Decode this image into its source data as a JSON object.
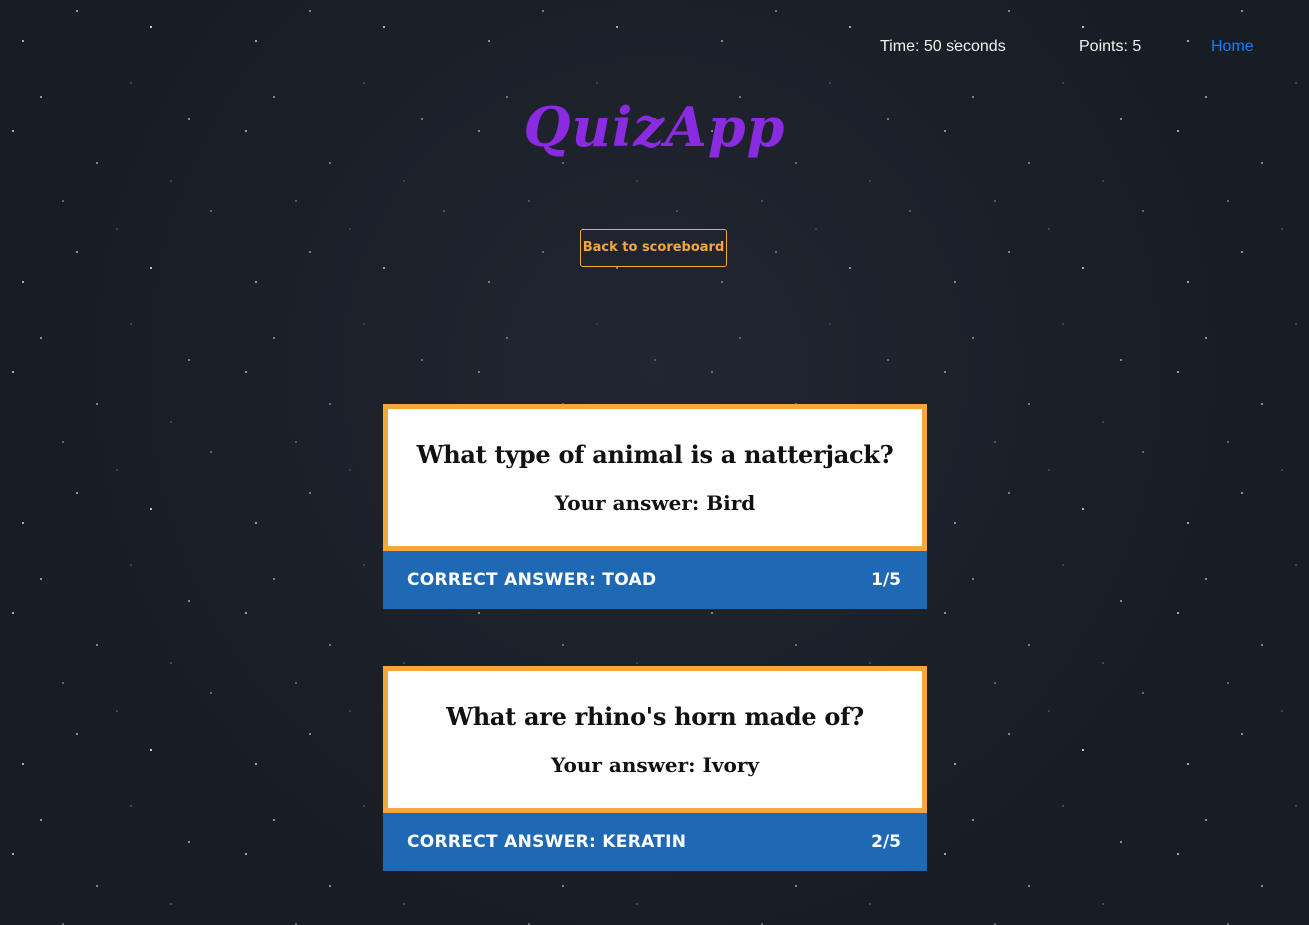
{
  "header": {
    "time_text": "Time: 50 seconds",
    "points_text": "Points: 5",
    "home_label": "Home"
  },
  "app_title": "QuizApp",
  "back_button_label": "Back to scoreboard",
  "results": [
    {
      "question": "What type of animal is a natterjack?",
      "your_answer": "Your answer: Bird",
      "correct_answer": "CORRECT ANSWER: TOAD",
      "progress": "1/5"
    },
    {
      "question": "What are rhino's horn made of?",
      "your_answer": "Your answer: Ivory",
      "correct_answer": "CORRECT ANSWER: KERATIN",
      "progress": "2/5"
    }
  ],
  "colors": {
    "background": "#181c24",
    "title": "#8a2be2",
    "accent_orange": "#f5a73a",
    "answer_bar_blue": "#1f68b3",
    "link_blue": "#1e7cf0"
  }
}
